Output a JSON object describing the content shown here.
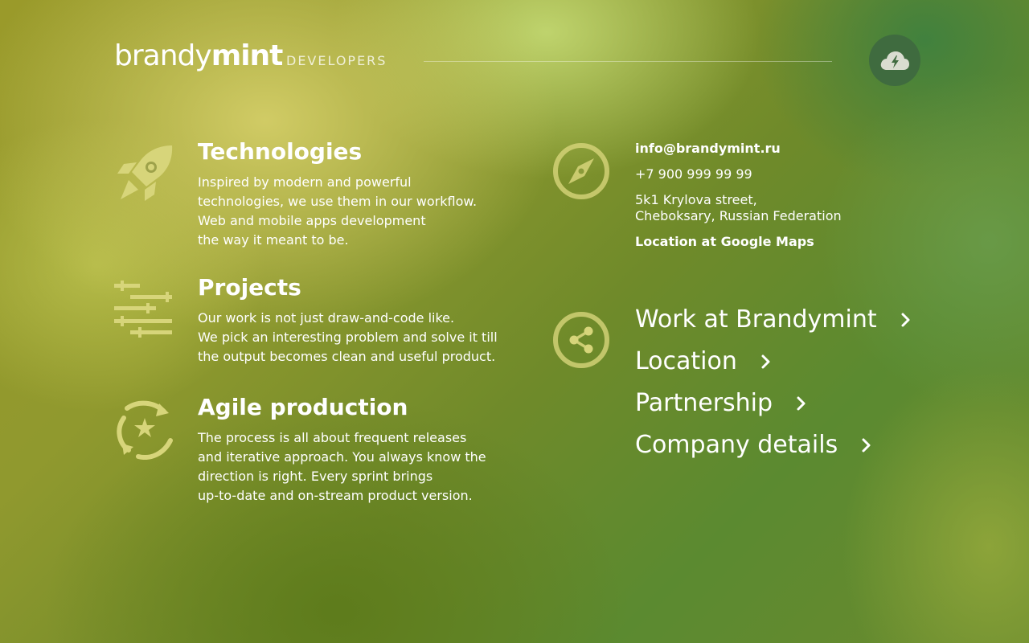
{
  "header": {
    "logo_light": "brandy",
    "logo_bold": "mint",
    "subtitle": "DEVELOPERS"
  },
  "colors": {
    "accent_icon": "#d7d57a",
    "cloud_button_bg": "#3f6b3f",
    "text": "#ffffff"
  },
  "features": [
    {
      "icon": "rocket-icon",
      "title": "Technologies",
      "lines": [
        "Inspired by modern and powerful",
        "technologies, we use them in our workflow.",
        "Web and mobile apps development",
        "the way it meant to be."
      ]
    },
    {
      "icon": "sliders-icon",
      "title": "Projects",
      "lines": [
        "Our work is not just draw-and-code like.",
        "We pick an interesting problem and solve it till",
        "the output becomes clean and useful product."
      ]
    },
    {
      "icon": "cycle-star-icon",
      "title": "Agile production",
      "lines": [
        "The process is all about frequent releases",
        "and iterative approach. You always know the",
        "direction is right. Every sprint brings",
        "up-to-date and on-stream product version."
      ]
    }
  ],
  "contact": {
    "email": "info@brandymint.ru",
    "phone": "+7 900 999 99 99",
    "address_line1": "5k1 Krylova street,",
    "address_line2": "Cheboksary, Russian Federation",
    "maps_link": "Location at Google Maps"
  },
  "nav": [
    {
      "label": "Work at Brandymint"
    },
    {
      "label": "Location"
    },
    {
      "label": "Partnership"
    },
    {
      "label": "Company details"
    }
  ]
}
